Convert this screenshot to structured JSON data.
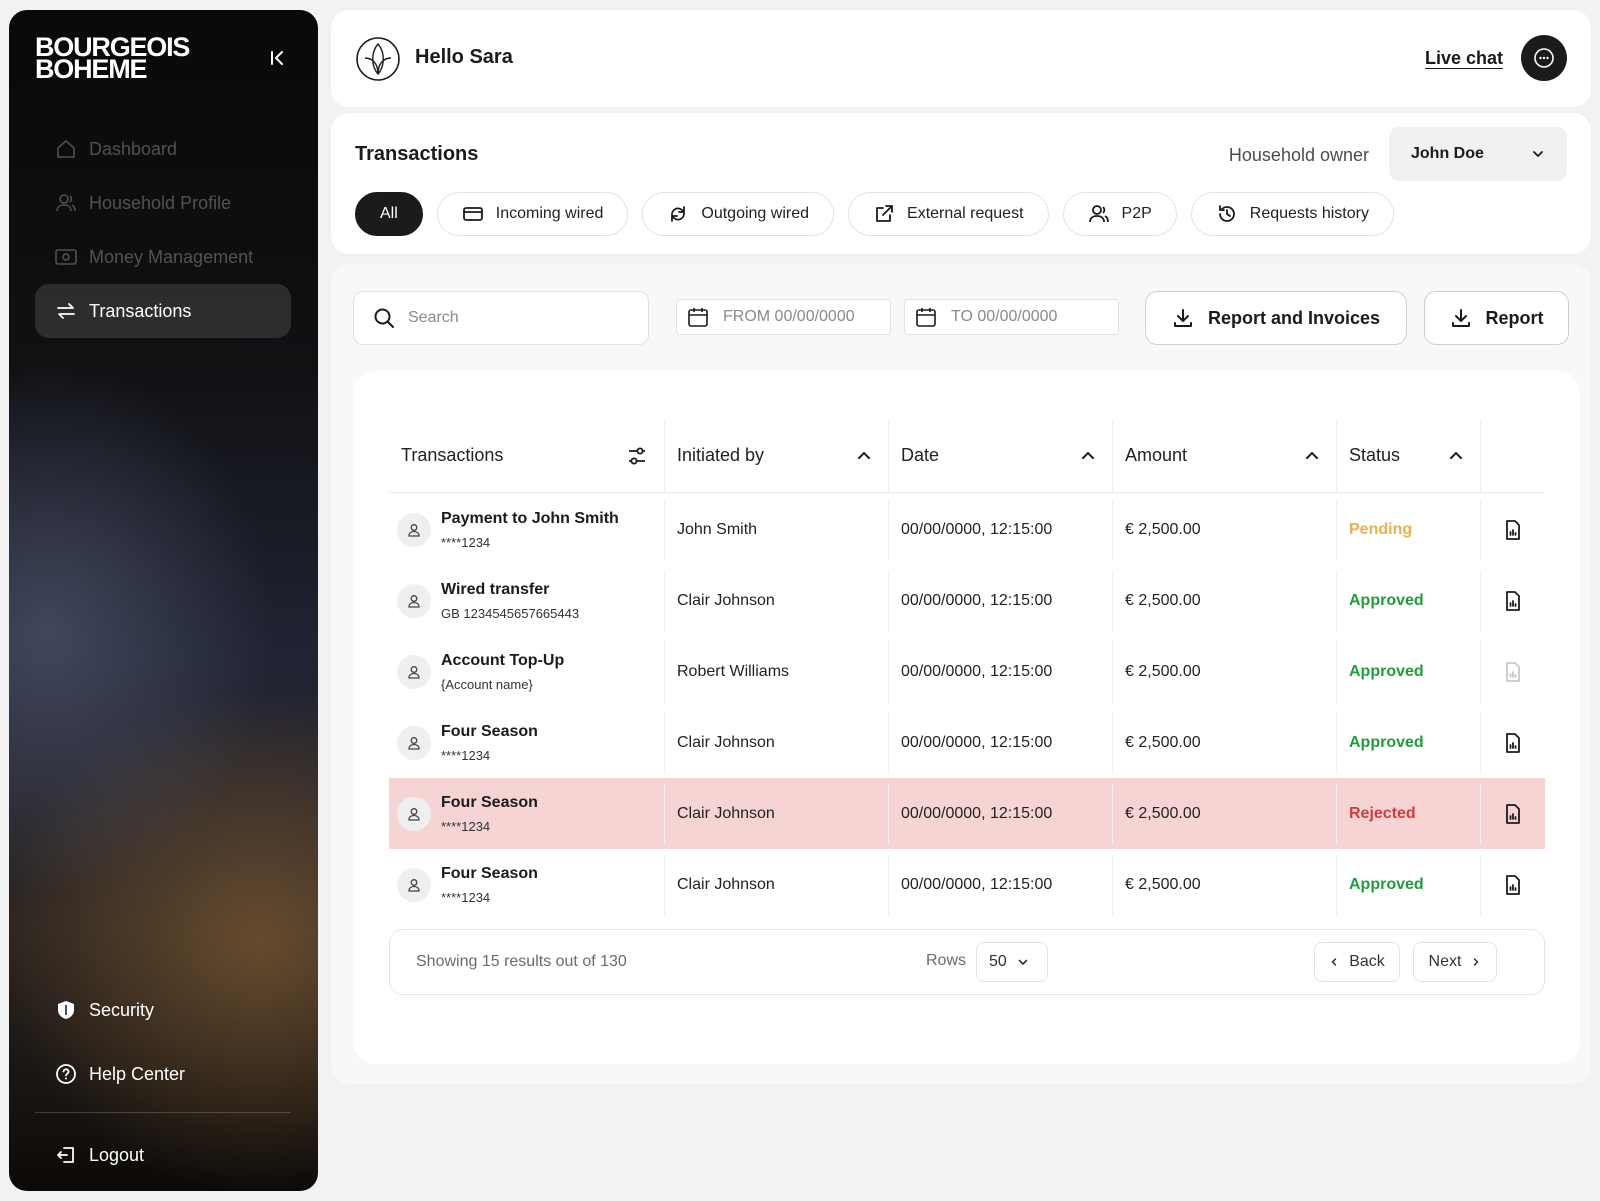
{
  "brand": {
    "line1": "BOURGEOIS",
    "line2": "BOHEME"
  },
  "sidebar": {
    "items": [
      {
        "label": "Dashboard",
        "icon": "home-icon"
      },
      {
        "label": "Household Profile",
        "icon": "users-icon"
      },
      {
        "label": "Money Management",
        "icon": "cash-icon"
      },
      {
        "label": "Transactions",
        "icon": "transfer-arrows-icon",
        "active": true
      }
    ],
    "bottom": [
      {
        "label": "Security",
        "icon": "shield-icon"
      },
      {
        "label": "Help Center",
        "icon": "help-icon"
      },
      {
        "label": "Logout",
        "icon": "logout-icon"
      }
    ]
  },
  "header": {
    "greeting": "Hello Sara",
    "live_chat": "Live chat"
  },
  "filters": {
    "title": "Transactions",
    "owner_label": "Household owner",
    "owner_value": "John Doe",
    "pills": [
      {
        "label": "All",
        "active": true
      },
      {
        "label": "Incoming wired",
        "icon": "card-icon"
      },
      {
        "label": "Outgoing wired",
        "icon": "sync-icon"
      },
      {
        "label": "External request",
        "icon": "external-link-icon"
      },
      {
        "label": "P2P",
        "icon": "users-icon"
      },
      {
        "label": "Requests history",
        "icon": "history-icon"
      }
    ]
  },
  "toolbar": {
    "search_placeholder": "Search",
    "from_placeholder": "FROM 00/00/0000",
    "to_placeholder": "TO 00/00/0000",
    "report_invoices": "Report and Invoices",
    "report": "Report"
  },
  "table": {
    "columns": [
      "Transactions",
      "Initiated by",
      "Date",
      "Amount",
      "Status"
    ],
    "rows": [
      {
        "title": "Payment to John Smith",
        "sub": "****1234",
        "initiated": "John Smith",
        "date": "00/00/0000, 12:15:00",
        "amount": "€ 2,500.00",
        "status": "Pending"
      },
      {
        "title": "Wired transfer",
        "sub": "GB 1234545657665443",
        "initiated": "Clair Johnson",
        "date": "00/00/0000, 12:15:00",
        "amount": "€ 2,500.00",
        "status": "Approved"
      },
      {
        "title": "Account Top-Up",
        "sub": "{Account name}",
        "initiated": "Robert Williams",
        "date": "00/00/0000, 12:15:00",
        "amount": "€ 2,500.00",
        "status": "Approved"
      },
      {
        "title": "Four Season",
        "sub": "****1234",
        "initiated": "Clair Johnson",
        "date": "00/00/0000, 12:15:00",
        "amount": "€ 2,500.00",
        "status": "Approved"
      },
      {
        "title": "Four Season",
        "sub": "****1234",
        "initiated": "Clair Johnson",
        "date": "00/00/0000, 12:15:00",
        "amount": "€ 2,500.00",
        "status": "Rejected"
      },
      {
        "title": "Four Season",
        "sub": "****1234",
        "initiated": "Clair Johnson",
        "date": "00/00/0000, 12:15:00",
        "amount": "€ 2,500.00",
        "status": "Approved"
      }
    ]
  },
  "pagination": {
    "summary": "Showing 15 results out of 130",
    "rows_label": "Rows",
    "rows_value": "50",
    "back": "Back",
    "next": "Next"
  },
  "colors": {
    "pending": "#e8b24a",
    "approved": "#1f9d3a",
    "rejected": "#d63a3a",
    "rejected_row": "#f6d4d4",
    "dark": "#1b1b1b"
  }
}
